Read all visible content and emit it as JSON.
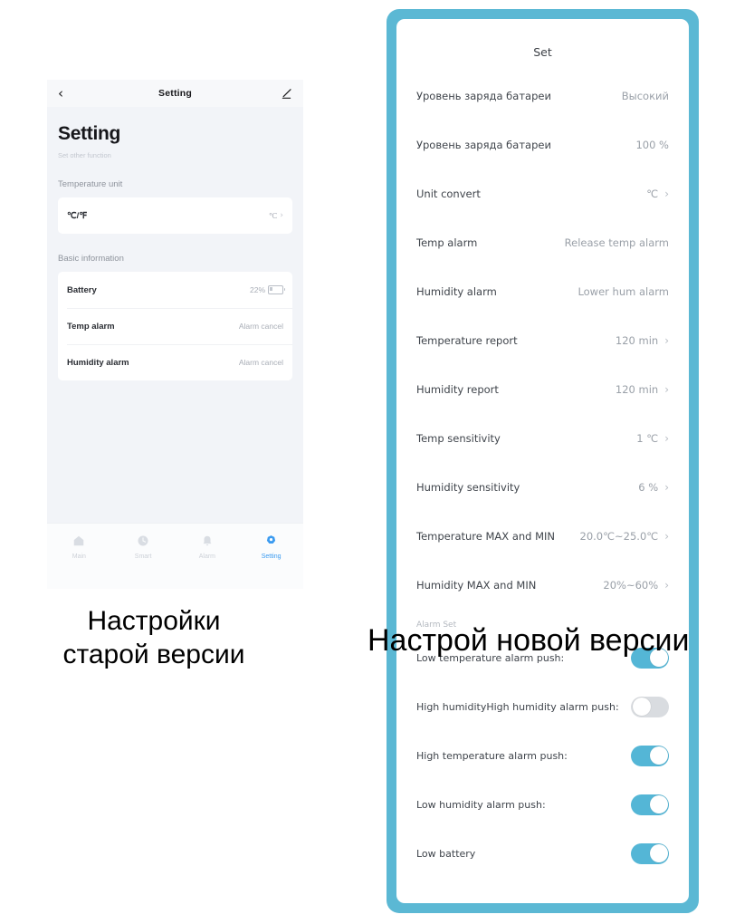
{
  "old_phone": {
    "navbar": {
      "back_icon": "chevron-left-icon",
      "title": "Setting",
      "edit_icon": "pencil-icon"
    },
    "page_title": "Setting",
    "page_subtitle": "Set other function",
    "sections": [
      {
        "label": "Temperature unit",
        "rows": [
          {
            "label": "℃/℉",
            "value": "℃",
            "chevron": "›",
            "icon": ""
          }
        ]
      },
      {
        "label": "Basic information",
        "rows": [
          {
            "label": "Battery",
            "value": "22%",
            "chevron": "›",
            "icon": "battery-icon"
          },
          {
            "label": "Temp alarm",
            "value": "Alarm cancel",
            "chevron": "",
            "icon": ""
          },
          {
            "label": "Humidity alarm",
            "value": "Alarm cancel",
            "chevron": "",
            "icon": ""
          }
        ]
      }
    ],
    "tabbar": [
      {
        "label": "Main",
        "icon": "home-icon",
        "active": false
      },
      {
        "label": "Smart",
        "icon": "clock-icon",
        "active": false
      },
      {
        "label": "Alarm",
        "icon": "bell-icon",
        "active": false
      },
      {
        "label": "Setting",
        "icon": "gear-icon",
        "active": true
      }
    ]
  },
  "new_phone": {
    "frame_color": "#5bb8d4",
    "title": "Set",
    "rows": [
      {
        "label": "Уровень заряда батареи",
        "value": "Высокий",
        "chevron": ""
      },
      {
        "label": "Уровень заряда батареи",
        "value": "100 %",
        "chevron": ""
      },
      {
        "label": "Unit convert",
        "value": "℃",
        "chevron": "›"
      },
      {
        "label": "Temp alarm",
        "value": "Release temp alarm",
        "chevron": ""
      },
      {
        "label": "Humidity alarm",
        "value": "Lower hum alarm",
        "chevron": ""
      },
      {
        "label": "Temperature report",
        "value": "120 min",
        "chevron": "›"
      },
      {
        "label": "Humidity report",
        "value": "120 min",
        "chevron": "›"
      },
      {
        "label": "Temp sensitivity",
        "value": "1 ℃",
        "chevron": "›"
      },
      {
        "label": "Humidity sensitivity",
        "value": "6 %",
        "chevron": "›"
      },
      {
        "label": "Temperature MAX and MIN",
        "value": "20.0℃~25.0℃",
        "chevron": "›"
      },
      {
        "label": "Humidity MAX and MIN",
        "value": "20%~60%",
        "chevron": "›"
      }
    ],
    "alarm_section_label": "Alarm Set",
    "toggles": [
      {
        "label": "Low temperature alarm push:",
        "on": true
      },
      {
        "label": "High humidityHigh humidity alarm push:",
        "on": false
      },
      {
        "label": "High temperature alarm push:",
        "on": true
      },
      {
        "label": "Low humidity alarm push:",
        "on": true
      },
      {
        "label": "Low battery",
        "on": true
      }
    ]
  },
  "captions": {
    "old_line1": "Настройки",
    "old_line2": "старой версии",
    "new": "Настрой новой версии"
  }
}
